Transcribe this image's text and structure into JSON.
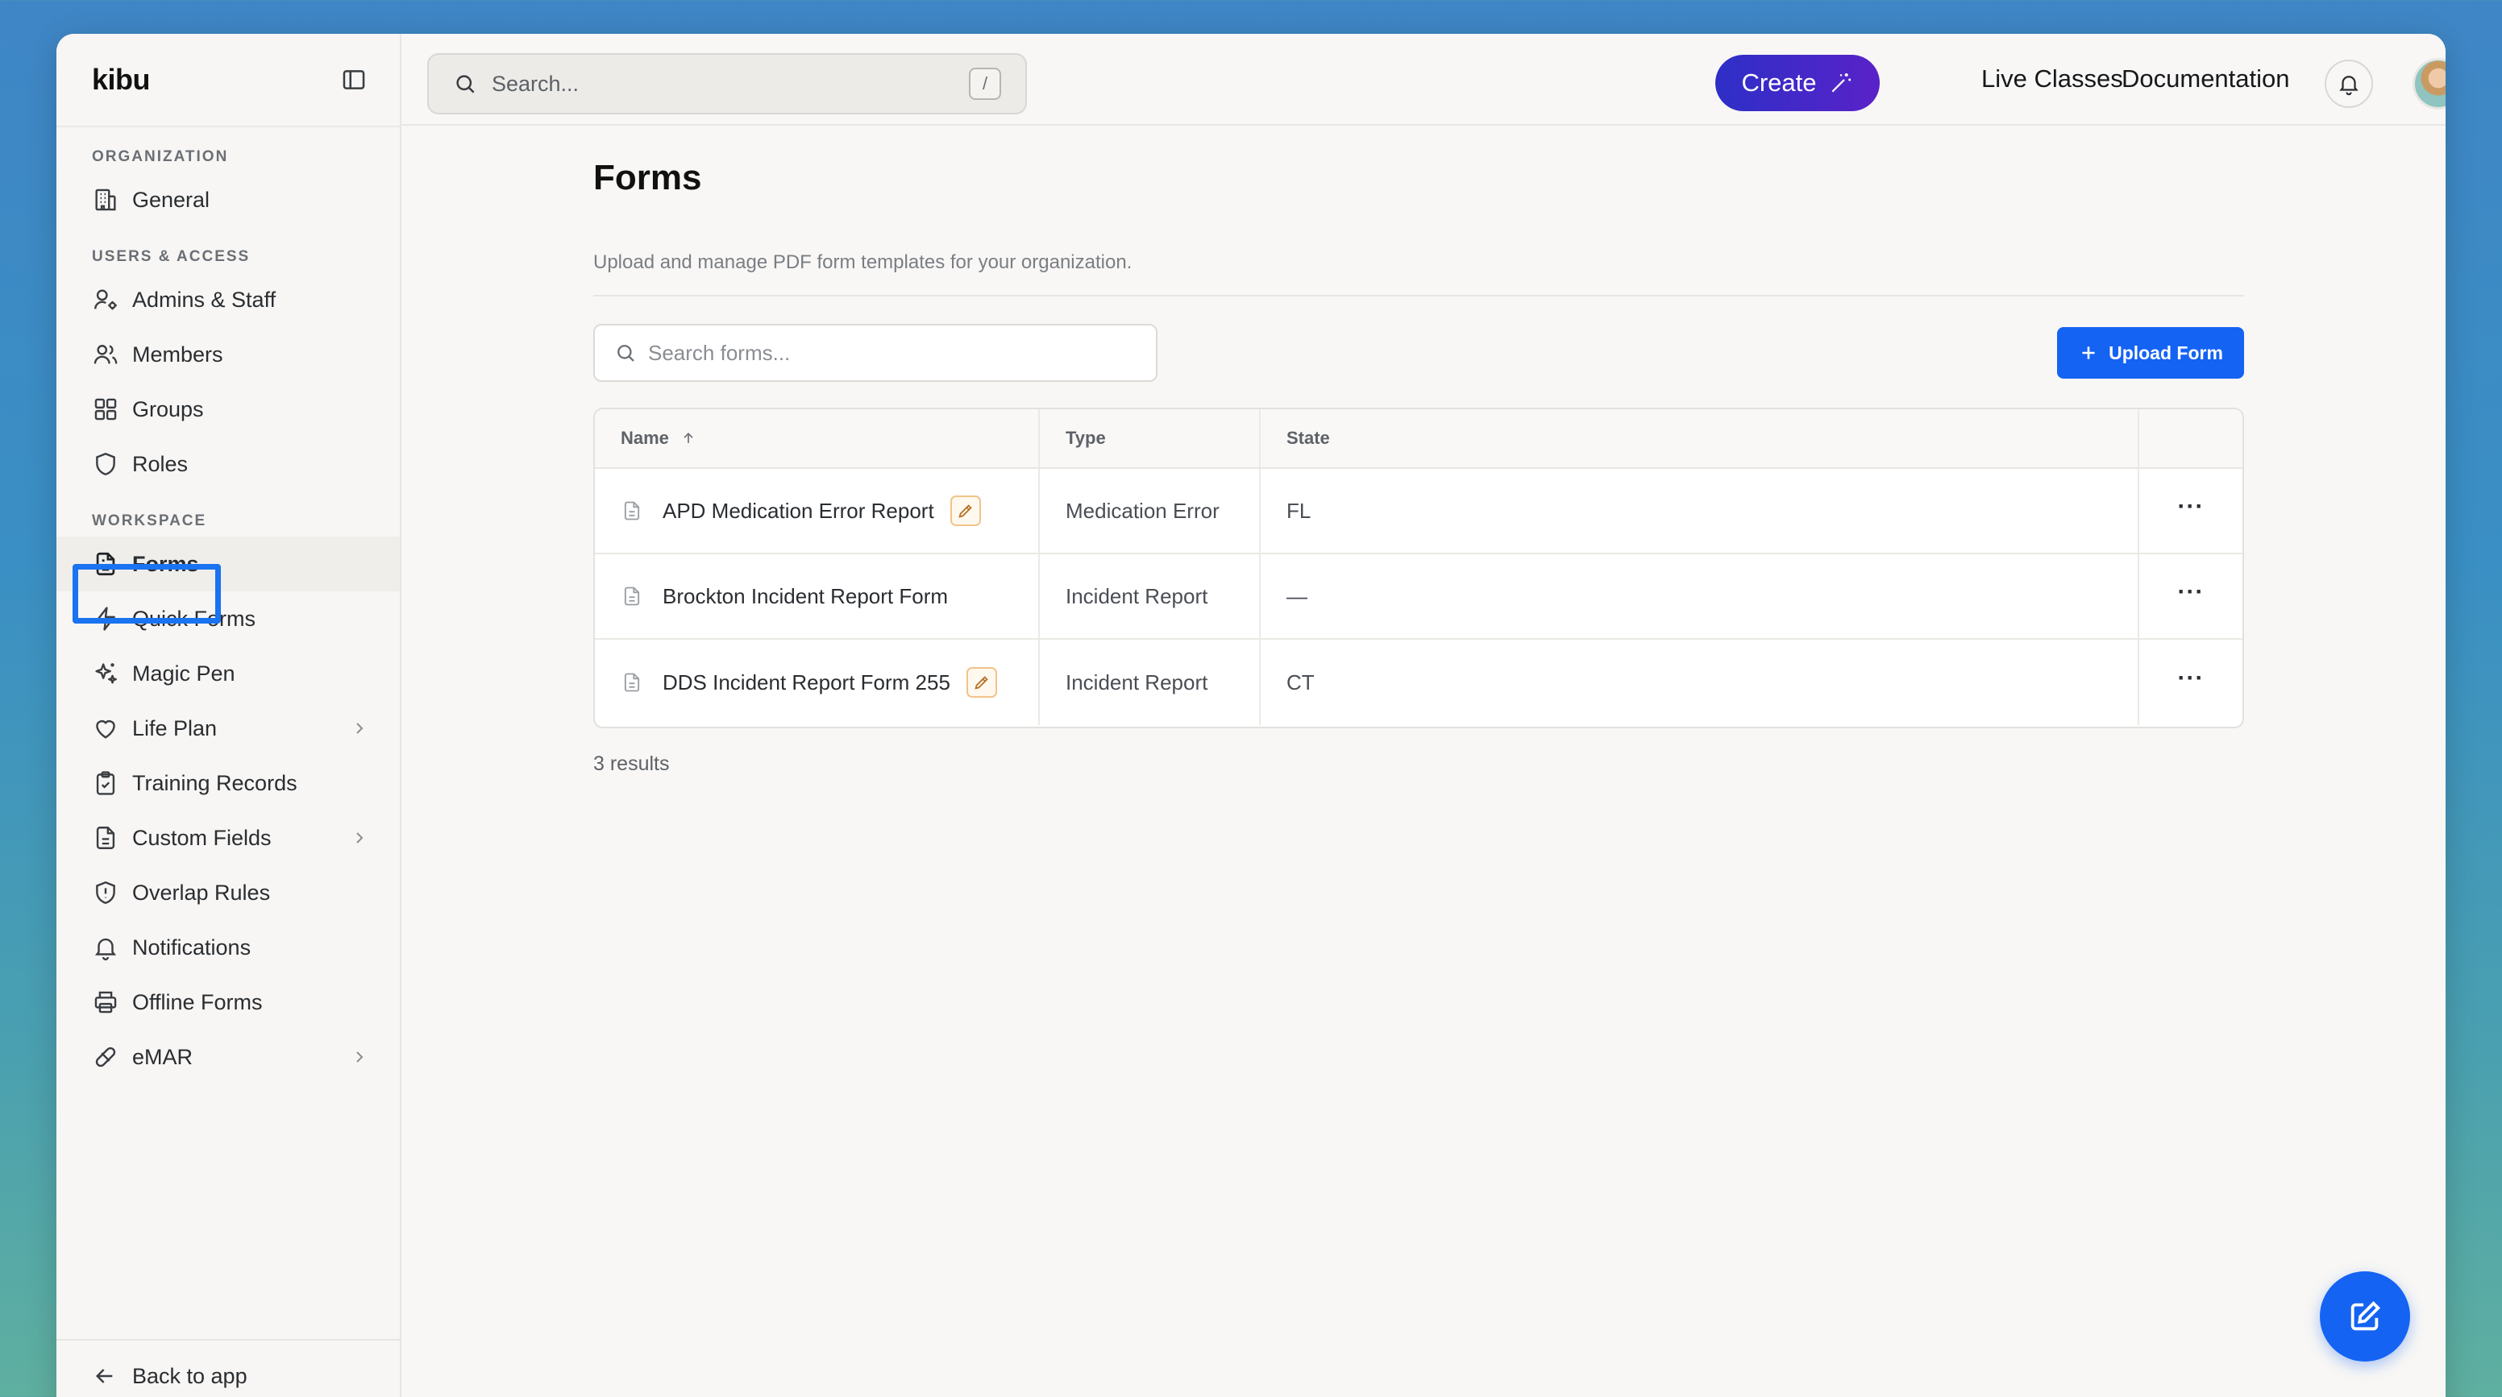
{
  "brand": "kibu",
  "sidebar": {
    "sections": {
      "organization": "ORGANIZATION",
      "users_access": "USERS & ACCESS",
      "workspace": "WORKSPACE"
    },
    "items": {
      "general": "General",
      "admins_staff": "Admins & Staff",
      "members": "Members",
      "groups": "Groups",
      "roles": "Roles",
      "forms": "Forms",
      "quick_forms": "Quick Forms",
      "magic_pen": "Magic Pen",
      "life_plan": "Life Plan",
      "training_records": "Training Records",
      "custom_fields": "Custom Fields",
      "overlap_rules": "Overlap Rules",
      "notifications": "Notifications",
      "offline_forms": "Offline Forms",
      "emar": "eMAR"
    },
    "active_item": "forms",
    "back_label": "Back to app"
  },
  "topbar": {
    "search_placeholder": "Search...",
    "search_shortcut": "/",
    "create_label": "Create",
    "live_classes": "Live Classes",
    "documentation": "Documentation"
  },
  "page": {
    "title": "Forms",
    "subtitle": "Upload and manage PDF form templates for your organization.",
    "search_placeholder": "Search forms...",
    "upload_label": "Upload Form",
    "columns": {
      "name": "Name",
      "type": "Type",
      "state": "State"
    },
    "rows": [
      {
        "name": "APD Medication Error Report",
        "type": "Medication Error",
        "state": "FL",
        "editable": true
      },
      {
        "name": "Brockton Incident Report Form",
        "type": "Incident Report",
        "state": "—",
        "editable": false
      },
      {
        "name": "DDS Incident Report Form 255",
        "type": "Incident Report",
        "state": "CT",
        "editable": true
      }
    ],
    "more_label": "···",
    "results": "3 results"
  },
  "colors": {
    "accent": "#1463f3",
    "create_gradient_start": "#2d2fc7",
    "create_gradient_end": "#5a22c8",
    "active_outline": "#1a73f0",
    "edit_badge_border": "#f0c48a"
  }
}
